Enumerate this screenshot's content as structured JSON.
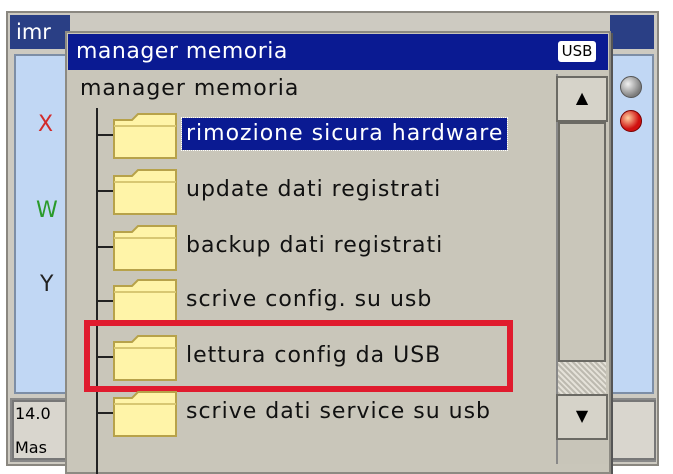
{
  "background_window": {
    "title_partial": "imr",
    "axis_labels": [
      {
        "text": "X",
        "color": "#d22b2b"
      },
      {
        "text": "W",
        "color": "#2a9a2a"
      },
      {
        "text": "Y",
        "color": "#222222"
      }
    ],
    "bottom_value": "14.0",
    "bottom_label": "Mas"
  },
  "dialog": {
    "title": "manager memoria",
    "badge": "USB",
    "tree_root": "manager memoria",
    "items": [
      {
        "label": "rimozione sicura hardware",
        "selected": true
      },
      {
        "label": "update dati registrati",
        "selected": false
      },
      {
        "label": "backup dati registrati",
        "selected": false
      },
      {
        "label": "scrive config. su usb",
        "selected": false
      },
      {
        "label": "lettura config da USB",
        "selected": false,
        "highlighted": true
      },
      {
        "label": "scrive dati service su usb",
        "selected": false
      }
    ]
  },
  "scrollbar": {
    "up_icon": "triangle-up-icon",
    "down_icon": "triangle-down-icon"
  },
  "colors": {
    "title_bar": "#0a1a92",
    "selection": "#0a1a92",
    "highlight": "#e01b2e",
    "folder": "#fff4a8"
  }
}
